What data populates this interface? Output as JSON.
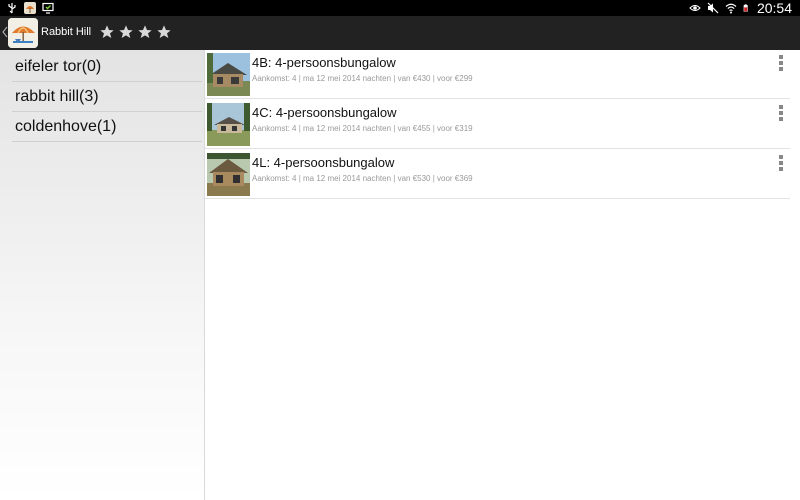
{
  "status_bar": {
    "time": "20:54",
    "icons_left": [
      "usb-icon",
      "app-notification-icon",
      "screen-icon"
    ],
    "icons_right": [
      "eye-icon",
      "mute-icon",
      "wifi-icon",
      "battery-icon"
    ]
  },
  "action_bar": {
    "title": "Rabbit Hill",
    "rating": 4,
    "rating_max": 4,
    "background_color": "#222222"
  },
  "sidebar": {
    "items": [
      {
        "label": "eifeler tor(0)"
      },
      {
        "label": "rabbit hill(3)"
      },
      {
        "label": "coldenhove(1)"
      }
    ]
  },
  "list": {
    "items": [
      {
        "title": "4B: 4-persoonsbungalow",
        "subtitle": "Aankomst: 4 | ma 12 mei 2014 nachten | van €430 | voor €299",
        "thumbnail": "bungalow-photo-4b"
      },
      {
        "title": "4C: 4-persoonsbungalow",
        "subtitle": "Aankomst: 4 | ma 12 mei 2014 nachten | van €455 | voor €319",
        "thumbnail": "bungalow-photo-4c"
      },
      {
        "title": "4L: 4-persoonsbungalow",
        "subtitle": "Aankomst: 4 | ma 12 mei 2014 nachten | van €530 | voor €369",
        "thumbnail": "bungalow-photo-4l"
      }
    ]
  }
}
